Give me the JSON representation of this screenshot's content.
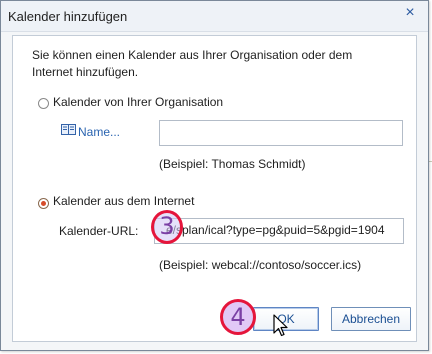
{
  "dialog": {
    "title": "Kalender hinzufügen",
    "close_glyph": "×",
    "intro": [
      "Sie können einen Kalender aus Ihrer Organisation oder dem",
      "Internet hinzufügen."
    ],
    "option_org": {
      "label": "Kalender von Ihrer Organisation",
      "selected": false
    },
    "name_link": "Name...",
    "name_value": "",
    "name_example": "(Beispiel: Thomas Schmidt)",
    "option_internet": {
      "label": "Kalender aus dem Internet",
      "selected": true
    },
    "url_label": "Kalender-URL:",
    "url_value": "e/splan/ical?type=pg&puid=5&pgid=1904",
    "url_example": "(Beispiel: webcal://contoso/soccer.ics)",
    "ok_label": "OK",
    "cancel_label": "Abbrechen"
  },
  "annotations": {
    "step_3": "3",
    "step_4": "4"
  },
  "colors": {
    "accent": "#2a64b0",
    "annotation_ring": "#e5153b",
    "radio_selected": "#d64b2a"
  }
}
